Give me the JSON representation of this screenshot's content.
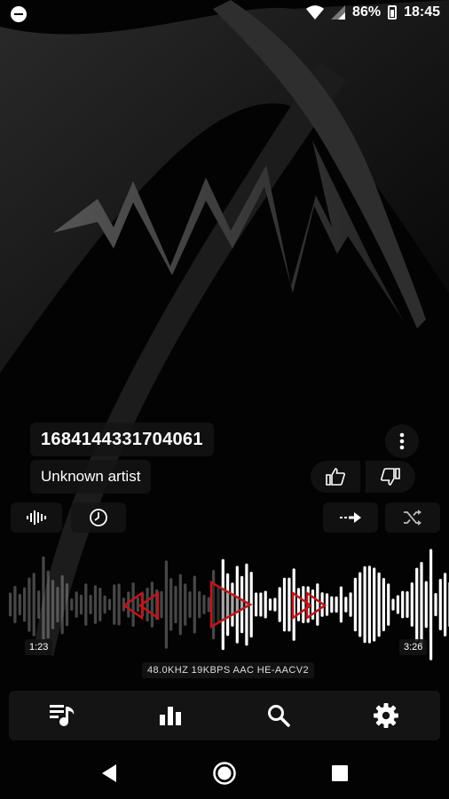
{
  "status_bar": {
    "battery_percent": "86%",
    "time": "18:45",
    "icons": [
      "minus-circle-icon",
      "wifi-icon",
      "signal-icon",
      "battery-icon"
    ]
  },
  "track": {
    "title": "1684144331704061",
    "artist": "Unknown artist"
  },
  "controls": {
    "more": "more-vertical-icon",
    "like": "thumbs-up-icon",
    "dislike": "thumbs-down-icon",
    "waveform_toggle": "waveform-icon",
    "sleep_timer": "clock-icon",
    "repeat": "repeat-arrow-icon",
    "shuffle": "shuffle-icon",
    "previous": "rewind-icon",
    "play": "play-icon",
    "next": "fast-forward-icon"
  },
  "playback": {
    "elapsed": "1:23",
    "total": "3:26",
    "progress": 0.403,
    "format": "48.0KHZ  19KBPS  AAC HE-AACV2"
  },
  "bottom_nav": [
    {
      "name": "playlist",
      "icon": "playlist-music-icon"
    },
    {
      "name": "equalizer",
      "icon": "bar-chart-icon"
    },
    {
      "name": "search",
      "icon": "search-icon"
    },
    {
      "name": "settings",
      "icon": "gear-icon"
    }
  ],
  "system_nav": [
    "back-icon",
    "home-icon",
    "recents-icon"
  ],
  "colors": {
    "accent": "#c0151b",
    "background": "#000000",
    "surface": "#141414"
  }
}
